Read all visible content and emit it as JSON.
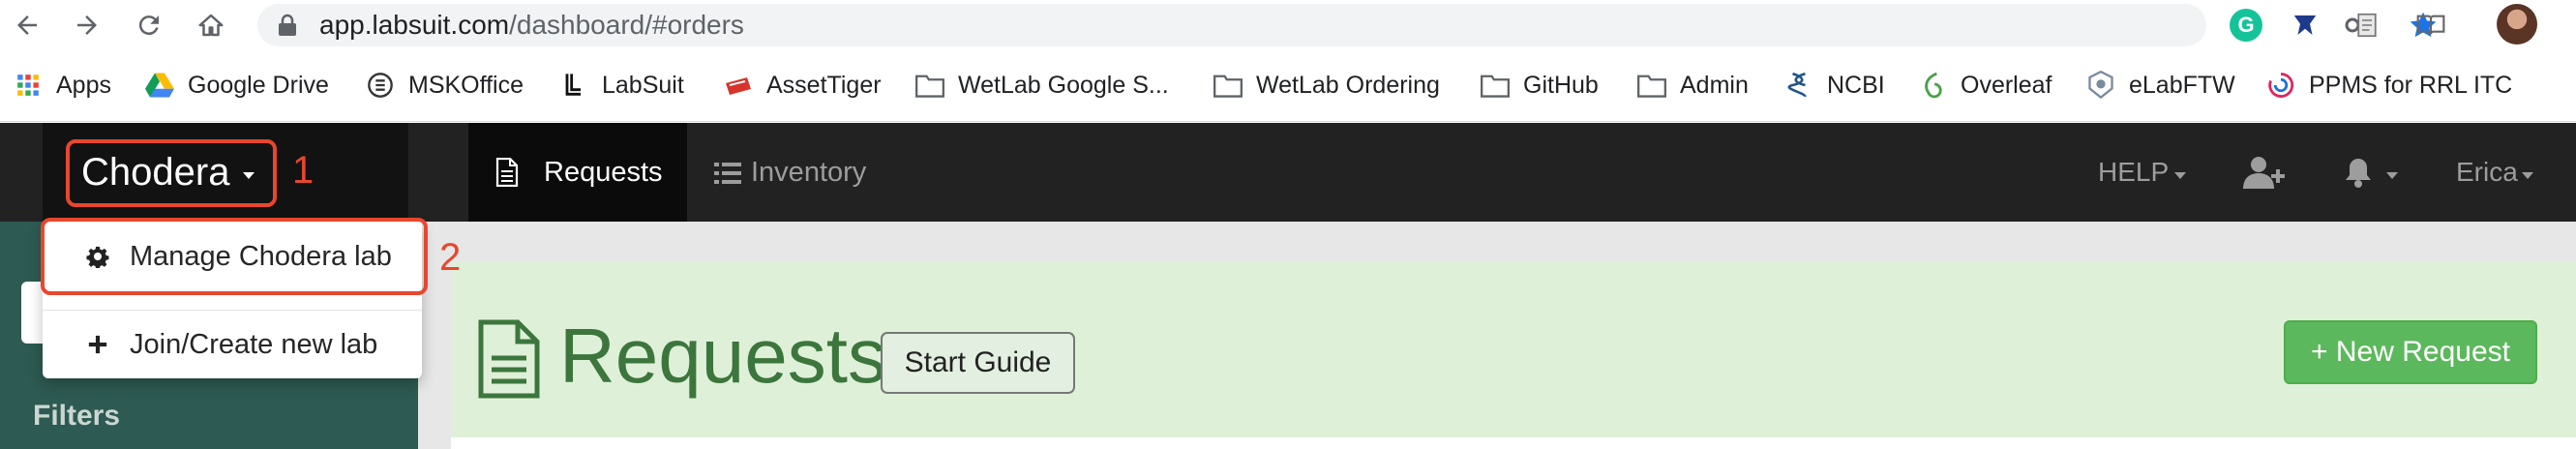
{
  "browser": {
    "url_host": "app.labsuit.com",
    "url_path": "/dashboard/#orders",
    "icons": [
      "back-icon",
      "forward-icon",
      "reload-icon",
      "home-icon",
      "lock-icon",
      "key-icon",
      "star-icon",
      "grammarly-icon",
      "extension-icon",
      "page-icon",
      "reader-icon",
      "profile-avatar"
    ],
    "grammarly_letter": "G"
  },
  "bookmarks": [
    {
      "label": "Apps",
      "icon": "apps-grid-icon"
    },
    {
      "label": "Google Drive",
      "icon": "google-drive-icon"
    },
    {
      "label": "MSKOffice",
      "icon": "mskoffice-icon"
    },
    {
      "label": "LabSuit",
      "icon": "labsuit-icon"
    },
    {
      "label": "AssetTiger",
      "icon": "assettiger-icon"
    },
    {
      "label": "WetLab Google S...",
      "icon": "folder-icon"
    },
    {
      "label": "WetLab Ordering",
      "icon": "folder-icon"
    },
    {
      "label": "GitHub",
      "icon": "folder-icon"
    },
    {
      "label": "Admin",
      "icon": "folder-icon"
    },
    {
      "label": "NCBI",
      "icon": "ncbi-icon"
    },
    {
      "label": "Overleaf",
      "icon": "overleaf-icon"
    },
    {
      "label": "eLabFTW",
      "icon": "elabftw-icon"
    },
    {
      "label": "PPMS for RRL ITC",
      "icon": "ppms-icon"
    }
  ],
  "navbar": {
    "brand": "Chodera",
    "tabs": [
      {
        "label": "Requests",
        "active": true,
        "icon": "document-icon"
      },
      {
        "label": "Inventory",
        "active": false,
        "icon": "list-icon"
      }
    ],
    "help": "HELP",
    "user": "Erica"
  },
  "dropdown": {
    "items": [
      {
        "label": "Manage Chodera lab",
        "icon": "gear-icon"
      },
      {
        "label": "Join/Create new lab",
        "icon": "plus-icon"
      }
    ]
  },
  "annotations": {
    "callout_1": "1",
    "callout_2": "2",
    "color": "#e8472d"
  },
  "sidebar": {
    "filters_label": "Filters"
  },
  "main": {
    "title": "Requests",
    "start_guide": "Start Guide",
    "new_request": "+ New Request"
  },
  "colors": {
    "navbar": "#222222",
    "sidebar": "#2d5a52",
    "panel": "#dff0d8",
    "title": "#3c763d",
    "success": "#5cb85c"
  }
}
